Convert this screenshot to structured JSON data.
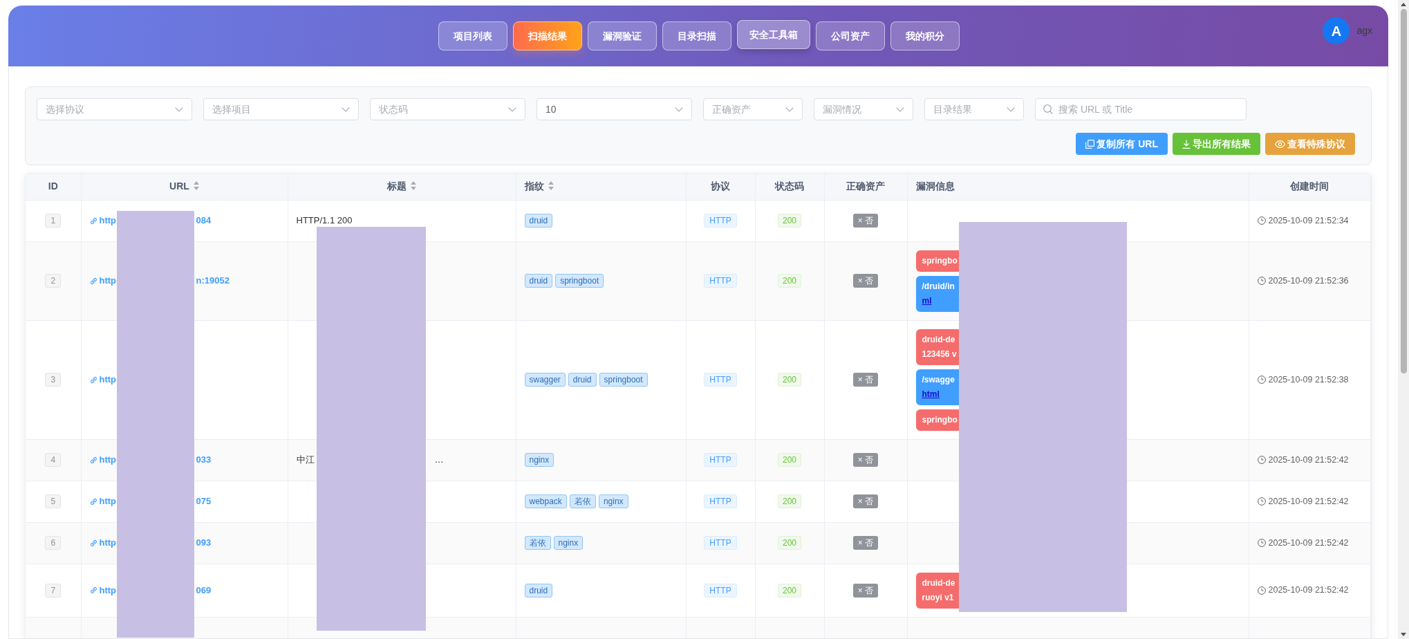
{
  "header": {
    "nav": [
      {
        "label": "项目列表",
        "selected": false,
        "hovered": false
      },
      {
        "label": "扫描结果",
        "selected": true,
        "hovered": false
      },
      {
        "label": "漏洞验证",
        "selected": false,
        "hovered": false
      },
      {
        "label": "目录扫描",
        "selected": false,
        "hovered": false
      },
      {
        "label": "安全工具箱",
        "selected": false,
        "hovered": true
      },
      {
        "label": "公司资产",
        "selected": false,
        "hovered": false
      },
      {
        "label": "我的积分",
        "selected": false,
        "hovered": false
      }
    ],
    "user": {
      "avatar": "A",
      "name": "agx"
    }
  },
  "filters": {
    "selects": [
      {
        "placeholder": "选择协议"
      },
      {
        "placeholder": "选择项目"
      },
      {
        "placeholder": "状态码"
      },
      {
        "value": "10"
      },
      {
        "placeholder": "正确资产"
      },
      {
        "placeholder": "漏洞情况"
      },
      {
        "placeholder": "目录结果"
      }
    ],
    "search": {
      "placeholder": "搜索 URL 或 Title"
    },
    "actions": [
      {
        "label": "复制所有 URL",
        "kind": "copy"
      },
      {
        "label": "导出所有结果",
        "kind": "export"
      },
      {
        "label": "查看特殊协议",
        "kind": "view"
      }
    ]
  },
  "table": {
    "columns": [
      {
        "label": "ID",
        "sortable": false
      },
      {
        "label": "URL",
        "sortable": true
      },
      {
        "label": "标题",
        "sortable": true
      },
      {
        "label": "指纹",
        "sortable": true
      },
      {
        "label": "协议",
        "sortable": false
      },
      {
        "label": "状态码",
        "sortable": false
      },
      {
        "label": "正确资产",
        "sortable": false
      },
      {
        "label": "漏洞信息",
        "sortable": false
      },
      {
        "label": "创建时间",
        "sortable": false
      }
    ],
    "rows": [
      {
        "id": "1",
        "url": [
          "http",
          "084"
        ],
        "title": [
          "HTTP/1.1 200"
        ],
        "fingerprints": [
          "druid"
        ],
        "protocol": "HTTP",
        "status": {
          "code": "200",
          "kind": "success"
        },
        "asset": "× 否",
        "vulns": [],
        "created": "2025-10-09 21:52:34"
      },
      {
        "id": "2",
        "url": [
          "http",
          "n:19052"
        ],
        "title": [],
        "fingerprints": [
          "druid",
          "springboot"
        ],
        "protocol": "HTTP",
        "status": {
          "code": "200",
          "kind": "success"
        },
        "asset": "× 否",
        "vulns": [
          {
            "color": "#f56c6c",
            "lines": [
              "springbo"
            ]
          },
          {
            "color": "#409eff",
            "lines": [
              "/druid/in"
            ],
            "link": "ml"
          }
        ],
        "created": "2025-10-09 21:52:36"
      },
      {
        "id": "3",
        "url": [
          "http"
        ],
        "title": [],
        "fingerprints": [
          "swagger",
          "druid",
          "springboot"
        ],
        "protocol": "HTTP",
        "status": {
          "code": "200",
          "kind": "success"
        },
        "asset": "× 否",
        "vulns": [
          {
            "color": "#f56c6c",
            "lines": [
              "druid-de",
              "123456 v"
            ]
          },
          {
            "color": "#409eff",
            "lines": [
              "/swagge"
            ],
            "link": "html"
          },
          {
            "color": "#f56c6c",
            "lines": [
              "springbo"
            ]
          }
        ],
        "created": "2025-10-09 21:52:38"
      },
      {
        "id": "4",
        "url": [
          "http",
          "033"
        ],
        "title": [
          "中江",
          "…"
        ],
        "fingerprints": [
          "nginx"
        ],
        "protocol": "HTTP",
        "status": {
          "code": "200",
          "kind": "success"
        },
        "asset": "× 否",
        "vulns": [],
        "created": "2025-10-09 21:52:42"
      },
      {
        "id": "5",
        "url": [
          "http",
          "075"
        ],
        "title": [],
        "fingerprints": [
          "webpack",
          "若依",
          "nginx"
        ],
        "protocol": "HTTP",
        "status": {
          "code": "200",
          "kind": "success"
        },
        "asset": "× 否",
        "vulns": [],
        "created": "2025-10-09 21:52:42"
      },
      {
        "id": "6",
        "url": [
          "http",
          "093"
        ],
        "title": [],
        "fingerprints": [
          "若依",
          "nginx"
        ],
        "protocol": "HTTP",
        "status": {
          "code": "200",
          "kind": "success"
        },
        "asset": "× 否",
        "vulns": [],
        "created": "2025-10-09 21:52:42"
      },
      {
        "id": "7",
        "url": [
          "http",
          "069"
        ],
        "title": [],
        "fingerprints": [
          "druid"
        ],
        "protocol": "HTTP",
        "status": {
          "code": "200",
          "kind": "success"
        },
        "asset": "× 否",
        "vulns": [
          {
            "color": "#f56c6c",
            "lines": [
              "druid-de",
              "ruoyi v1"
            ]
          }
        ],
        "created": "2025-10-09 21:52:42"
      }
    ]
  }
}
